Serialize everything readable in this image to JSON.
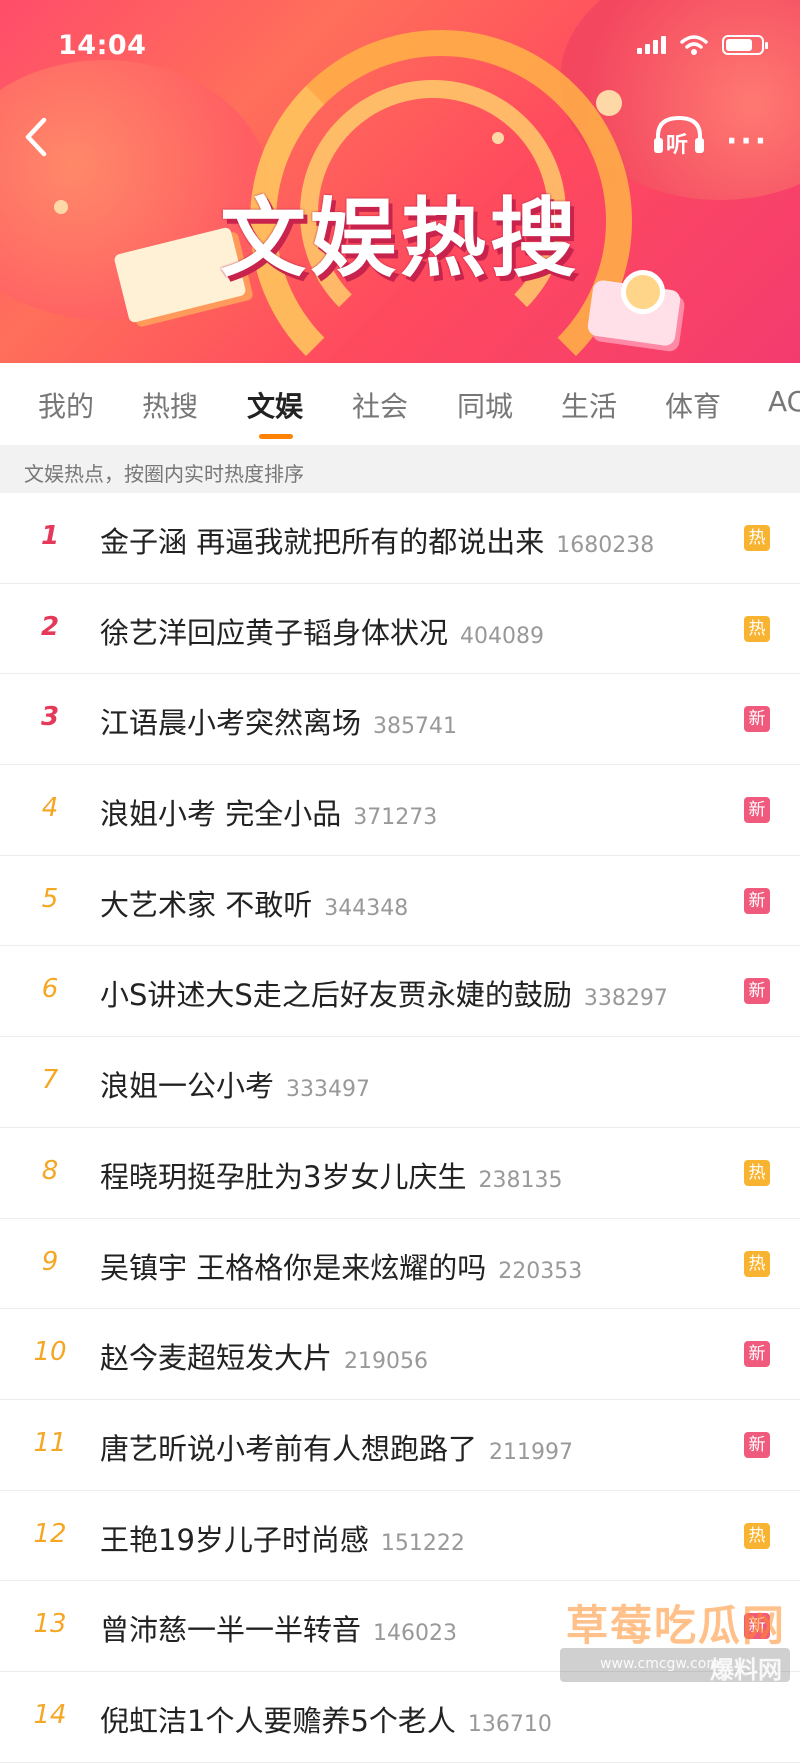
{
  "status_bar": {
    "time": "14:04"
  },
  "header": {
    "title": "文娱热搜",
    "listen_label": "听",
    "more_label": "···",
    "colors": {
      "banner": "#ff4d6a",
      "title_shadow": "#c8234c"
    }
  },
  "tabs": [
    {
      "label": "我的",
      "active": false
    },
    {
      "label": "热搜",
      "active": false
    },
    {
      "label": "文娱",
      "active": true
    },
    {
      "label": "社会",
      "active": false
    },
    {
      "label": "同城",
      "active": false
    },
    {
      "label": "生活",
      "active": false
    },
    {
      "label": "体育",
      "active": false
    },
    {
      "label": "AC",
      "active": false
    }
  ],
  "hint": "文娱热点，按圈内实时热度排序",
  "list": [
    {
      "rank": "1",
      "title": "金子涵 再逼我就把所有的都说出来",
      "count": "1680238",
      "badge": "热"
    },
    {
      "rank": "2",
      "title": "徐艺洋回应黄子韬身体状况",
      "count": "404089",
      "badge": "热"
    },
    {
      "rank": "3",
      "title": "江语晨小考突然离场",
      "count": "385741",
      "badge": "新"
    },
    {
      "rank": "4",
      "title": "浪姐小考 完全小品",
      "count": "371273",
      "badge": "新"
    },
    {
      "rank": "5",
      "title": "大艺术家 不敢听",
      "count": "344348",
      "badge": "新"
    },
    {
      "rank": "6",
      "title": "小S讲述大S走之后好友贾永婕的鼓励",
      "count": "338297",
      "badge": "新"
    },
    {
      "rank": "7",
      "title": "浪姐一公小考",
      "count": "333497",
      "badge": ""
    },
    {
      "rank": "8",
      "title": "程晓玥挺孕肚为3岁女儿庆生",
      "count": "238135",
      "badge": "热"
    },
    {
      "rank": "9",
      "title": "吴镇宇 王格格你是来炫耀的吗",
      "count": "220353",
      "badge": "热"
    },
    {
      "rank": "10",
      "title": "赵今麦超短发大片",
      "count": "219056",
      "badge": "新"
    },
    {
      "rank": "11",
      "title": "唐艺昕说小考前有人想跑路了",
      "count": "211997",
      "badge": "新"
    },
    {
      "rank": "12",
      "title": "王艳19岁儿子时尚感",
      "count": "151222",
      "badge": "热"
    },
    {
      "rank": "13",
      "title": "曾沛慈一半一半转音",
      "count": "146023",
      "badge": "新"
    },
    {
      "rank": "14",
      "title": "倪虹洁1个人要赡养5个老人",
      "count": "136710",
      "badge": ""
    }
  ],
  "watermark": {
    "text": "草莓吃瓜网",
    "url": "www.cmcgw.com",
    "tag": "爆料网"
  },
  "colors": {
    "accent": "#ff8200",
    "rank_top": "#e6395a",
    "rank": "#f5a623",
    "hot": "#f8b431",
    "new": "#f05a7d"
  }
}
